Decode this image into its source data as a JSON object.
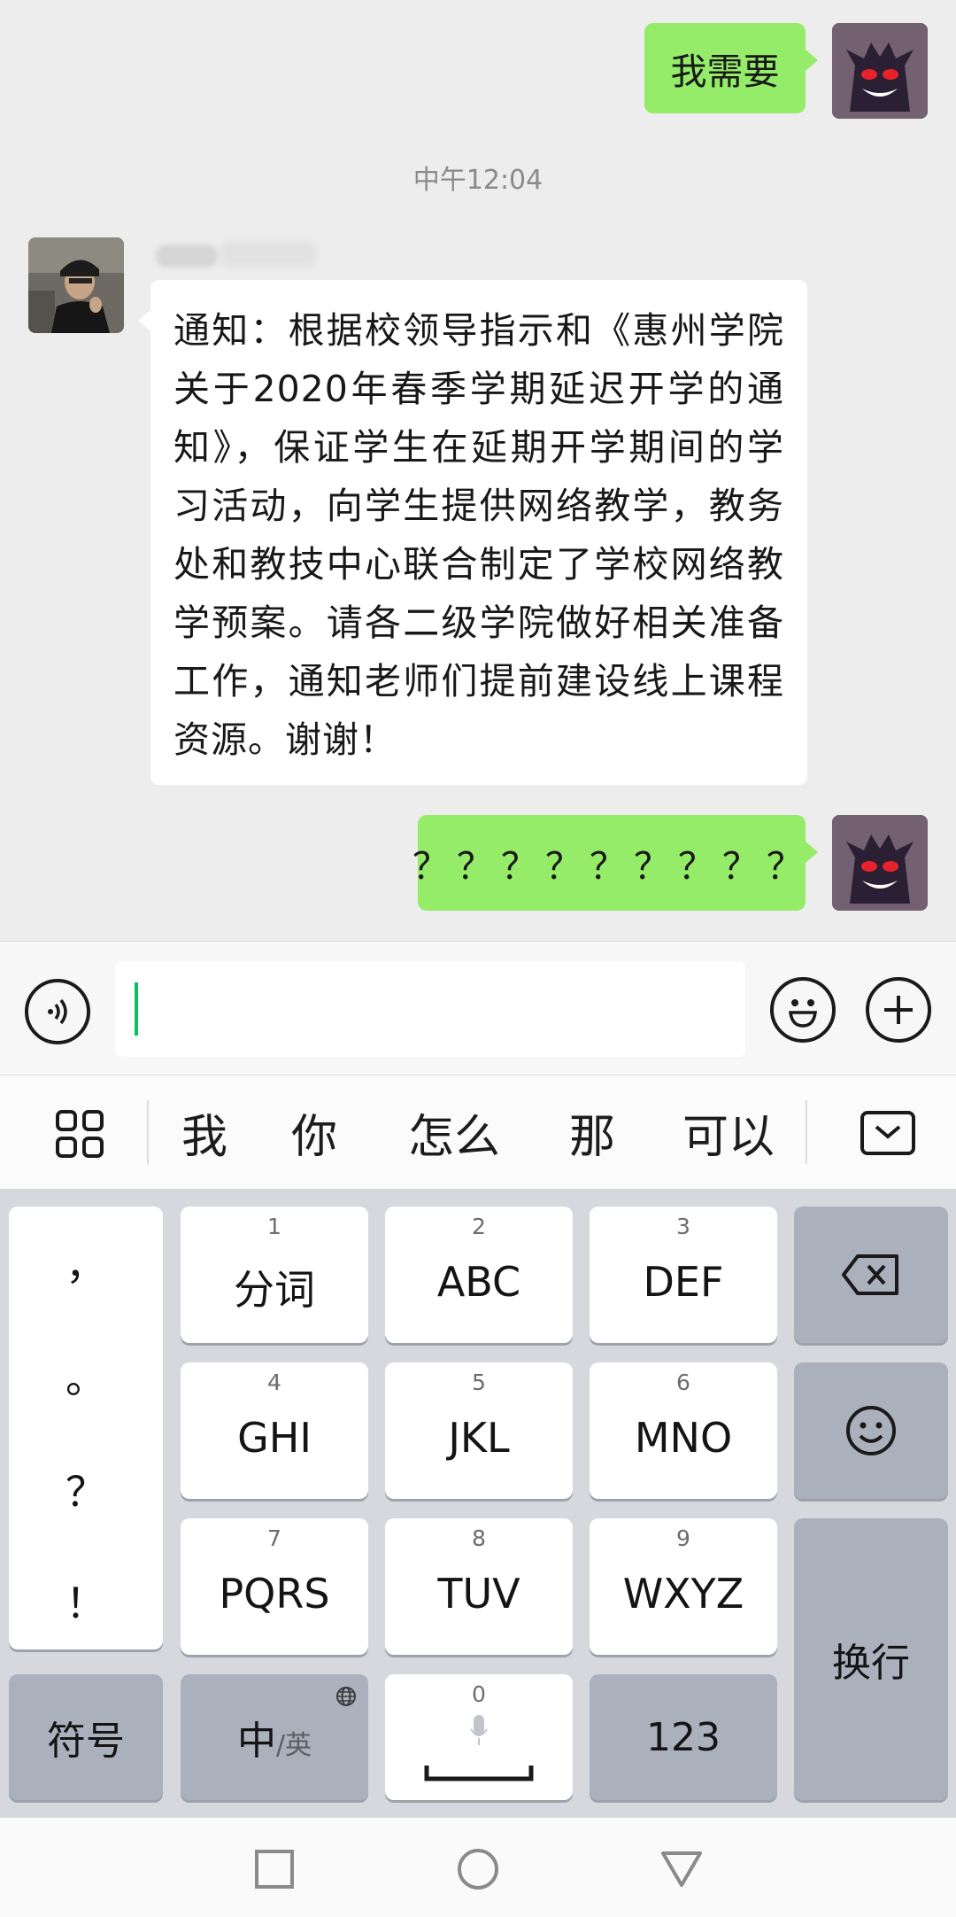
{
  "chat": {
    "messages": [
      {
        "side": "right",
        "text": "我需要"
      },
      {
        "side": "left",
        "text": "通知：根据校领导指示和《惠州学院关于2020年春季学期延迟开学的通知》，保证学生在延期开学期间的学习活动，向学生提供网络教学，教务处和教技中心联合制定了学校网络教学预案。请各二级学院做好相关准备工作，通知老师们提前建设线上课程资源。谢谢！"
      },
      {
        "side": "right",
        "text": "？？？？？？？？？"
      }
    ],
    "timestamp": "中午12:04"
  },
  "input": {
    "value": "",
    "icons": [
      "voice-icon",
      "emoji-icon",
      "plus-icon"
    ]
  },
  "candidates": {
    "items": [
      "我",
      "你",
      "怎么",
      "那",
      "可以"
    ],
    "icons": [
      "grid-icon",
      "collapse-keyboard-icon"
    ]
  },
  "keyboard": {
    "punctuation": [
      "，",
      "。",
      "？",
      "！"
    ],
    "keys": [
      {
        "num": "1",
        "label": "分词"
      },
      {
        "num": "2",
        "label": "ABC"
      },
      {
        "num": "3",
        "label": "DEF"
      },
      {
        "num": "4",
        "label": "GHI"
      },
      {
        "num": "5",
        "label": "JKL"
      },
      {
        "num": "6",
        "label": "MNO"
      },
      {
        "num": "7",
        "label": "PQRS"
      },
      {
        "num": "8",
        "label": "TUV"
      },
      {
        "num": "9",
        "label": "WXYZ"
      }
    ],
    "symbol_key": "符号",
    "lang_key_main": "中",
    "lang_key_sub": "/英",
    "space_num": "0",
    "numeric_key": "123",
    "enter_key": "换行",
    "icons": [
      "backspace-icon",
      "smiley-icon",
      "globe-icon",
      "microphone-icon"
    ]
  },
  "navbar": {
    "icons": [
      "recent-apps-icon",
      "home-icon",
      "back-icon"
    ]
  },
  "colors": {
    "sent_bubble": "#95ec69",
    "cursor": "#07c160",
    "chat_bg": "#ededed"
  }
}
